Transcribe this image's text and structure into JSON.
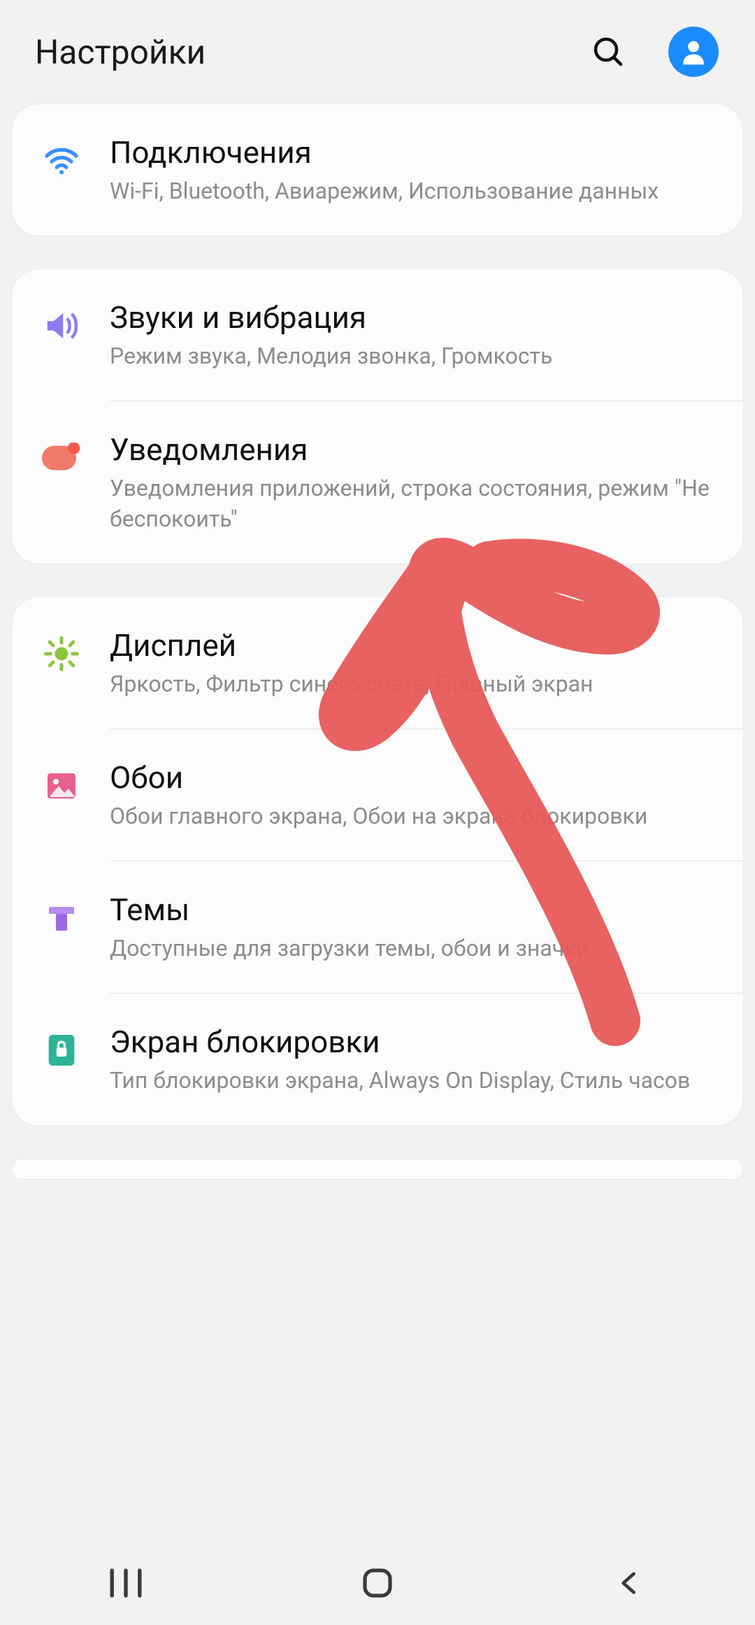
{
  "header": {
    "title": "Настройки"
  },
  "groups": [
    {
      "items": [
        {
          "id": "connections",
          "title": "Подключения",
          "sub": "Wi-Fi, Bluetooth, Авиарежим, Использование данных"
        }
      ]
    },
    {
      "items": [
        {
          "id": "sounds",
          "title": "Звуки и вибрация",
          "sub": "Режим звука, Мелодия звонка, Громкость"
        },
        {
          "id": "notifications",
          "title": "Уведомления",
          "sub": "Уведомления приложений, строка состояния, режим \"Не беспокоить\""
        }
      ]
    },
    {
      "items": [
        {
          "id": "display",
          "title": "Дисплей",
          "sub": "Яркость, Фильтр синего света, Главный экран"
        },
        {
          "id": "wallpaper",
          "title": "Обои",
          "sub": "Обои главного экрана, Обои на экране блокировки"
        },
        {
          "id": "themes",
          "title": "Темы",
          "sub": "Доступные для загрузки темы, обои и значки"
        },
        {
          "id": "lockscreen",
          "title": "Экран блокировки",
          "sub": "Тип блокировки экрана, Always On Display, Стиль часов"
        }
      ]
    }
  ]
}
